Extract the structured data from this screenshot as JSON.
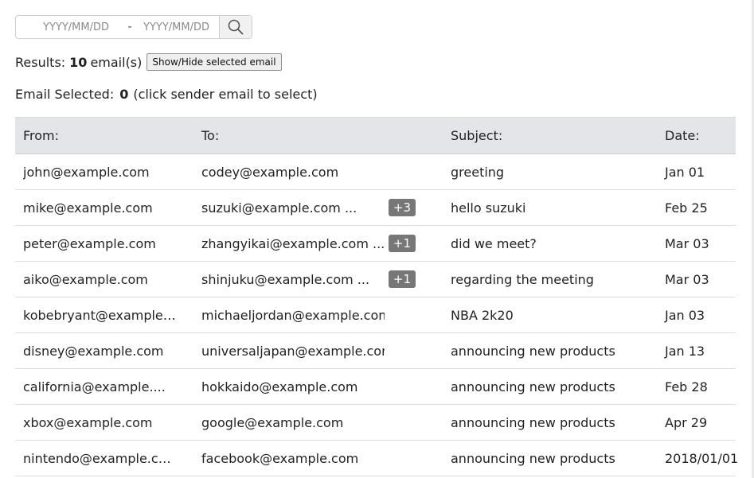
{
  "search": {
    "start_placeholder": "YYYY/MM/DD",
    "separator": "-",
    "end_placeholder": "YYYY/MM/DD",
    "search_icon": "search-icon"
  },
  "results": {
    "label": "Results:",
    "count": "10",
    "unit": "email(s)",
    "toggle_button": "Show/Hide selected email"
  },
  "selection": {
    "label": "Email Selected:",
    "count": "0",
    "hint": "(click sender email to select)"
  },
  "table": {
    "headers": {
      "from": "From:",
      "to": "To:",
      "subject": "Subject:",
      "date": "Date:"
    },
    "rows": [
      {
        "from": "john@example.com",
        "to": "codey@example.com",
        "badge": "",
        "subject": "greeting",
        "date": "Jan 01"
      },
      {
        "from": "mike@example.com",
        "to": "suzuki@example.com ...",
        "badge": "+3",
        "subject": "hello suzuki",
        "date": "Feb 25"
      },
      {
        "from": "peter@example.com",
        "to": "zhangyikai@example.com ...",
        "badge": "+1",
        "subject": "did we meet?",
        "date": "Mar 03"
      },
      {
        "from": "aiko@example.com",
        "to": "shinjuku@example.com ...",
        "badge": "+1",
        "subject": "regarding the meeting",
        "date": "Mar 03"
      },
      {
        "from": "kobebryant@example....",
        "to": "michaeljordan@example.com",
        "badge": "",
        "subject": "NBA 2k20",
        "date": "Jan 03"
      },
      {
        "from": "disney@example.com",
        "to": "universaljapan@example.com",
        "badge": "",
        "subject": "announcing new products",
        "date": "Jan 13"
      },
      {
        "from": "california@example....",
        "to": "hokkaido@example.com",
        "badge": "",
        "subject": "announcing new products",
        "date": "Feb 28"
      },
      {
        "from": "xbox@example.com",
        "to": "google@example.com",
        "badge": "",
        "subject": "announcing new products",
        "date": "Apr 29"
      },
      {
        "from": "nintendo@example.co...",
        "to": "facebook@example.com",
        "badge": "",
        "subject": "announcing new products",
        "date": "2018/01/01"
      }
    ]
  }
}
